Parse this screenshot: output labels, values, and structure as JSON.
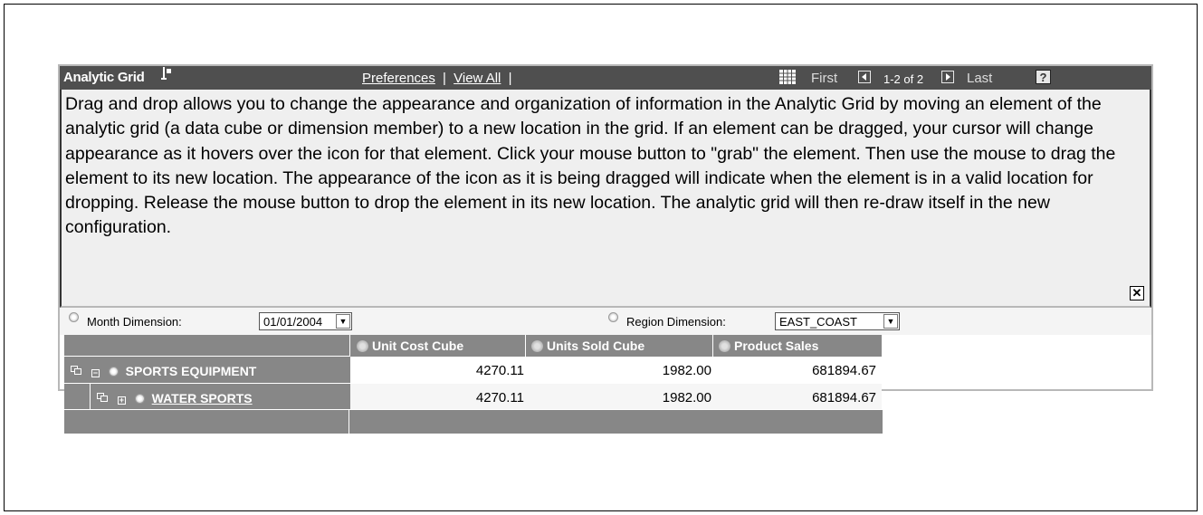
{
  "header": {
    "title": "Analytic Grid",
    "preferences": "Preferences",
    "separator1": "|",
    "view_all": "View All",
    "separator2": "|",
    "first": "First",
    "range": "1-2 of 2",
    "last": "Last",
    "help": "?"
  },
  "instructions": {
    "text": "Drag and drop allows you to change the appearance and organization of information in the Analytic Grid by moving an element of the analytic grid (a data cube or dimension member) to a new location in the grid. If an element can be dragged, your cursor will change appearance as it hovers over the icon for that element. Click your mouse button to \"grab\" the element. Then use the mouse to drag the element to its new location. The appearance of the icon as it is being dragged will indicate when the element is in a valid location for dropping. Release the mouse button to drop the element in its new location. The analytic grid will then re-draw itself in the new configuration.",
    "close": "✕"
  },
  "dimensions": {
    "month_label": "Month Dimension:",
    "month_value": "01/01/2004",
    "region_label": "Region Dimension:",
    "region_value": "EAST_COAST"
  },
  "grid": {
    "columns": [
      "Unit Cost Cube",
      "Units Sold Cube",
      "Product Sales"
    ],
    "rows": [
      {
        "label": "SPORTS EQUIPMENT",
        "expander": "−",
        "values": [
          "4270.11",
          "1982.00",
          "681894.67"
        ]
      },
      {
        "label": "WATER SPORTS",
        "expander": "+",
        "values": [
          "4270.11",
          "1982.00",
          "681894.67"
        ]
      }
    ]
  },
  "colors": {
    "header_bg": "#4f4f4f",
    "grid_gray": "#878787",
    "instructions_bg": "#efefef"
  }
}
